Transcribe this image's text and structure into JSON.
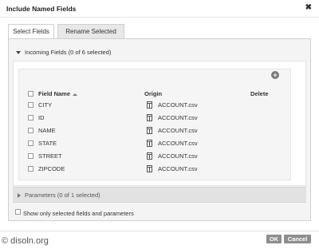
{
  "dialog": {
    "title": "Include Named Fields",
    "close_glyph": "✖"
  },
  "tabs": [
    {
      "label": "Select Fields"
    },
    {
      "label": "Rename Selected"
    }
  ],
  "incoming": {
    "label": "Incoming Fields (0 of 6 selected)"
  },
  "table": {
    "headers": {
      "name": "Field Name",
      "origin": "Origin",
      "delete": "Delete"
    },
    "rows": [
      {
        "name": "CITY",
        "origin": "ACCOUNT.csv"
      },
      {
        "name": "ID",
        "origin": "ACCOUNT.csv"
      },
      {
        "name": "NAME",
        "origin": "ACCOUNT.csv"
      },
      {
        "name": "STATE",
        "origin": "ACCOUNT.csv"
      },
      {
        "name": "STREET",
        "origin": "ACCOUNT.csv"
      },
      {
        "name": "ZIPCODE",
        "origin": "ACCOUNT.csv"
      }
    ]
  },
  "parameters": {
    "label": "Parameters (0 of 1 selected)"
  },
  "show_only": {
    "label": "Show only selected fields and parameters"
  },
  "watermark": "© disoln.org",
  "buttons": {
    "ok": "OK",
    "cancel": "Cancel"
  },
  "icons": {
    "add": "+",
    "close": "close-icon",
    "table": "table-icon"
  }
}
